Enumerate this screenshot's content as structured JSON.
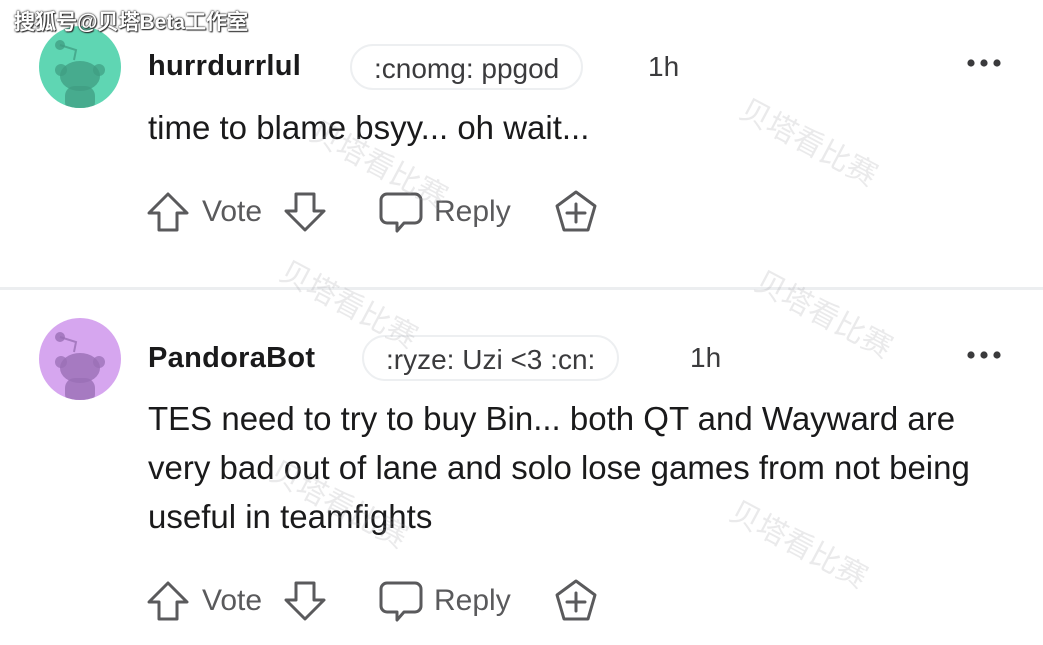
{
  "watermark": {
    "source": "搜狐号@贝塔Beta工作室",
    "overlay": "贝塔看比赛"
  },
  "colors": {
    "avatar_1_bg": "#5fd6b3",
    "avatar_2_bg": "#d6a6ef",
    "divider": "#eceef0",
    "text": "#1a1a1b",
    "muted": "#5a5a5c"
  },
  "comments": [
    {
      "username": "hurrdurrlul",
      "flair": ":cnomg: ppgod",
      "time": "1h",
      "text": "time to blame bsyy... oh wait...",
      "vote_label": "Vote",
      "reply_label": "Reply",
      "icons": [
        "snoo-avatar-icon",
        "more-options-icon",
        "upvote-arrow-icon",
        "downvote-arrow-icon",
        "reply-bubble-icon",
        "award-plus-icon"
      ]
    },
    {
      "username": "PandoraBot",
      "flair": ":ryze: Uzi <3 :cn:",
      "time": "1h",
      "text": "TES need to try to buy Bin... both QT and Wayward are very bad out of lane and solo lose games from not being useful in teamfights",
      "vote_label": "Vote",
      "reply_label": "Reply",
      "icons": [
        "snoo-avatar-icon",
        "more-options-icon",
        "upvote-arrow-icon",
        "downvote-arrow-icon",
        "reply-bubble-icon",
        "award-plus-icon"
      ]
    }
  ]
}
